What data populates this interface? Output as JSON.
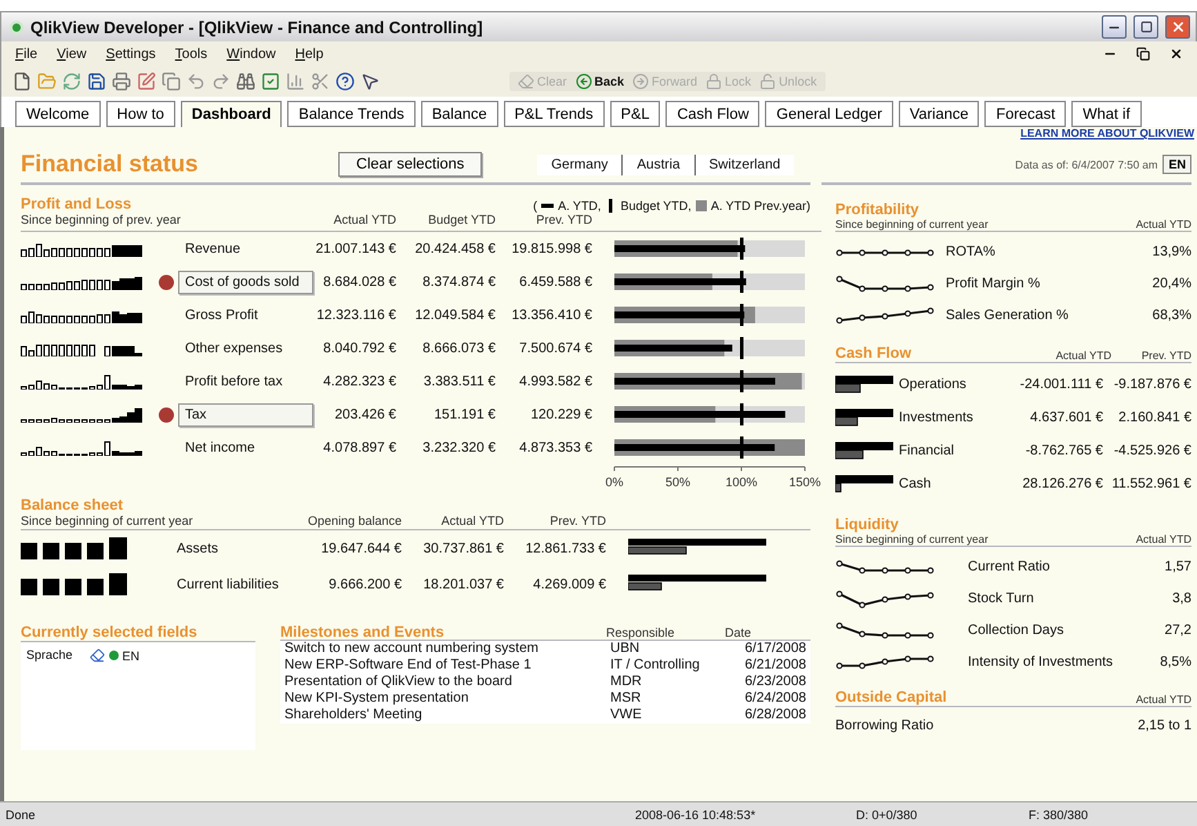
{
  "window": {
    "title": "QlikView Developer - [QlikView - Finance and Controlling]"
  },
  "menu": [
    "File",
    "View",
    "Settings",
    "Tools",
    "Window",
    "Help"
  ],
  "toolbar_nav": [
    {
      "label": "Clear",
      "disabled": true
    },
    {
      "label": "Back",
      "disabled": false
    },
    {
      "label": "Forward",
      "disabled": true
    },
    {
      "label": "Lock",
      "disabled": true
    },
    {
      "label": "Unlock",
      "disabled": true
    }
  ],
  "tabs": [
    {
      "label": "Welcome",
      "selected": false
    },
    {
      "label": "How to",
      "selected": false
    },
    {
      "label": "Dashboard",
      "selected": true
    },
    {
      "label": "Balance Trends",
      "selected": false
    },
    {
      "label": "Balance",
      "selected": false
    },
    {
      "label": "P&L Trends",
      "selected": false
    },
    {
      "label": "P&L",
      "selected": false
    },
    {
      "label": "Cash Flow",
      "selected": false
    },
    {
      "label": "General Ledger",
      "selected": false
    },
    {
      "label": "Variance",
      "selected": false
    },
    {
      "label": "Forecast",
      "selected": false
    },
    {
      "label": "What if",
      "selected": false
    }
  ],
  "learn_more_link": "LEARN MORE ABOUT QLIKVIEW",
  "header": {
    "title": "Financial status",
    "clear_button": "Clear selections",
    "countries": [
      "Germany",
      "Austria",
      "Switzerland"
    ],
    "data_as_of": "Data as of: 6/4/2007 7:50 am",
    "language_button": "EN"
  },
  "profit_and_loss": {
    "title": "Profit and Loss",
    "subtitle": "Since beginning of prev. year",
    "legend_prefix": "(",
    "legend": [
      "A. YTD,",
      "Budget YTD,",
      "A. YTD Prev.year)"
    ],
    "columns": [
      "Actual YTD",
      "Budget YTD",
      "Prev. YTD"
    ],
    "rows": [
      {
        "label": "Revenue",
        "flagged": false,
        "actual": "21.007.143 €",
        "budget": "20.424.458 €",
        "prev": "19.815.998 €"
      },
      {
        "label": "Cost of goods sold",
        "flagged": true,
        "actual": "8.684.028 €",
        "budget": "8.374.874 €",
        "prev": "6.459.588 €"
      },
      {
        "label": "Gross Profit",
        "flagged": false,
        "actual": "12.323.116 €",
        "budget": "12.049.584 €",
        "prev": "13.356.410 €"
      },
      {
        "label": "Other expenses",
        "flagged": false,
        "actual": "8.040.792 €",
        "budget": "8.666.073 €",
        "prev": "7.500.674 €"
      },
      {
        "label": "Profit before tax",
        "flagged": false,
        "actual": "4.282.323 €",
        "budget": "3.383.511 €",
        "prev": "4.993.582 €"
      },
      {
        "label": "Tax",
        "flagged": true,
        "actual": "203.426 €",
        "budget": "151.191 €",
        "prev": "120.229 €"
      },
      {
        "label": "Net income",
        "flagged": false,
        "actual": "4.078.897 €",
        "budget": "3.232.320 €",
        "prev": "4.873.353 €"
      }
    ],
    "axis_labels": [
      "0%",
      "50%",
      "100%",
      "150%"
    ]
  },
  "balance_sheet": {
    "title": "Balance sheet",
    "subtitle": "Since beginning of current year",
    "columns": [
      "Opening balance",
      "Actual YTD",
      "Prev. YTD"
    ],
    "rows": [
      {
        "label": "Assets",
        "opening": "19.647.644 €",
        "actual": "30.737.861 €",
        "prev": "12.861.733 €"
      },
      {
        "label": "Current liabilities",
        "opening": "9.666.200 €",
        "actual": "18.201.037 €",
        "prev": "4.269.009 €"
      }
    ]
  },
  "selected_fields": {
    "title": "Currently selected fields",
    "items": [
      {
        "field": "Sprache",
        "value": "EN"
      }
    ]
  },
  "milestones": {
    "title": "Milestones and Events",
    "columns": [
      "Responsible",
      "Date"
    ],
    "rows": [
      {
        "event": "Switch to new account numbering system",
        "responsible": "UBN",
        "date": "6/17/2008"
      },
      {
        "event": "New ERP-Software End of Test-Phase 1",
        "responsible": "IT / Controlling",
        "date": "6/21/2008"
      },
      {
        "event": "Presentation of QlikView to the board",
        "responsible": "MDR",
        "date": "6/23/2008"
      },
      {
        "event": "New KPI-System presentation",
        "responsible": "MSR",
        "date": "6/24/2008"
      },
      {
        "event": "Shareholders' Meeting",
        "responsible": "VWE",
        "date": "6/28/2008"
      }
    ]
  },
  "profitability": {
    "title": "Profitability",
    "subtitle": "Since beginning of current year",
    "column": "Actual YTD",
    "rows": [
      {
        "label": "ROTA%",
        "value": "13,9%"
      },
      {
        "label": "Profit Margin %",
        "value": "20,4%"
      },
      {
        "label": "Sales Generation %",
        "value": "68,3%"
      }
    ]
  },
  "cash_flow": {
    "title": "Cash Flow",
    "columns": [
      "Actual YTD",
      "Prev. YTD"
    ],
    "rows": [
      {
        "label": "Operations",
        "actual": "-24.001.111 €",
        "prev": "-9.187.876 €"
      },
      {
        "label": "Investments",
        "actual": "4.637.601 €",
        "prev": "2.160.841 €"
      },
      {
        "label": "Financial",
        "actual": "-8.762.765 €",
        "prev": "-4.525.926 €"
      },
      {
        "label": "Cash",
        "actual": "28.126.276 €",
        "prev": "11.552.961 €"
      }
    ]
  },
  "liquidity": {
    "title": "Liquidity",
    "subtitle": "Since beginning of current year",
    "column": "Actual YTD",
    "rows": [
      {
        "label": "Current Ratio",
        "value": "1,57"
      },
      {
        "label": "Stock Turn",
        "value": "3,8"
      },
      {
        "label": "Collection Days",
        "value": "27,2"
      },
      {
        "label": "Intensity of Investments",
        "value": "8,5%"
      }
    ]
  },
  "outside_capital": {
    "title": "Outside Capital",
    "column": "Actual YTD",
    "rows": [
      {
        "label": "Borrowing Ratio",
        "value": "2,15 to 1"
      }
    ]
  },
  "status_bar": [
    "Done",
    "2008-06-16 10:48:53*",
    "D: 0+0/380",
    "F: 380/380"
  ]
}
